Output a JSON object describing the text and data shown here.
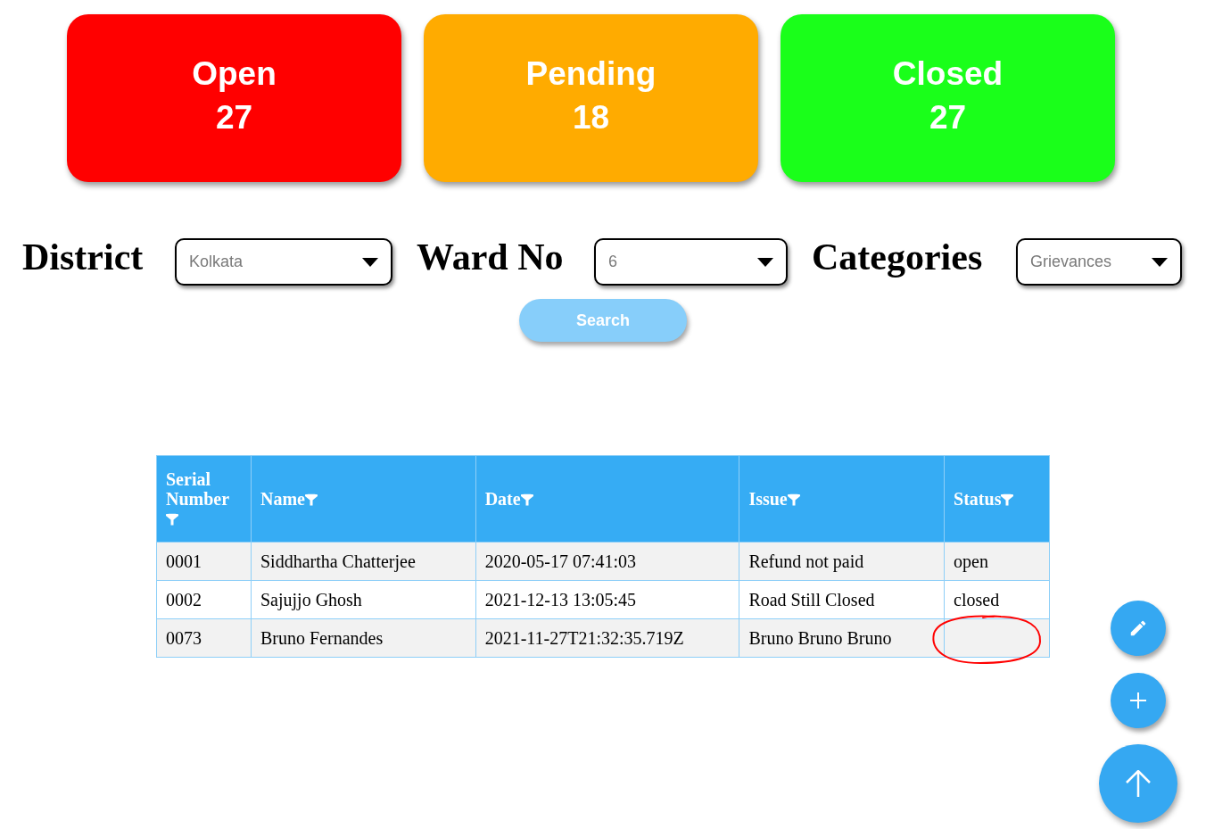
{
  "status_cards": [
    {
      "label": "Open",
      "count": "27",
      "color": "#ff0000"
    },
    {
      "label": "Pending",
      "count": "18",
      "color": "#ffab00"
    },
    {
      "label": "Closed",
      "count": "27",
      "color": "#1aff1a"
    }
  ],
  "filters": [
    {
      "label": "District",
      "value": "Kolkata"
    },
    {
      "label": "Ward No",
      "value": "6"
    },
    {
      "label": "Categories",
      "value": "Grievances"
    }
  ],
  "search_button": {
    "label": "Search"
  },
  "table": {
    "columns": [
      {
        "label": "Serial Number"
      },
      {
        "label": "Name"
      },
      {
        "label": "Date"
      },
      {
        "label": "Issue"
      },
      {
        "label": "Status"
      }
    ],
    "rows": [
      {
        "cells": [
          "0001",
          "Siddhartha Chatterjee",
          "2020-05-17 07:41:03",
          "Refund not paid",
          "open"
        ],
        "circled": false
      },
      {
        "cells": [
          "0002",
          "Sajujjo Ghosh",
          "2021-12-13 13:05:45",
          "Road Still Closed",
          "closed"
        ],
        "circled": false
      },
      {
        "cells": [
          "0073",
          "Bruno Fernandes",
          "2021-11-27T21:32:35.719Z",
          "Bruno Bruno Bruno"
        ],
        "circled": true
      }
    ]
  }
}
